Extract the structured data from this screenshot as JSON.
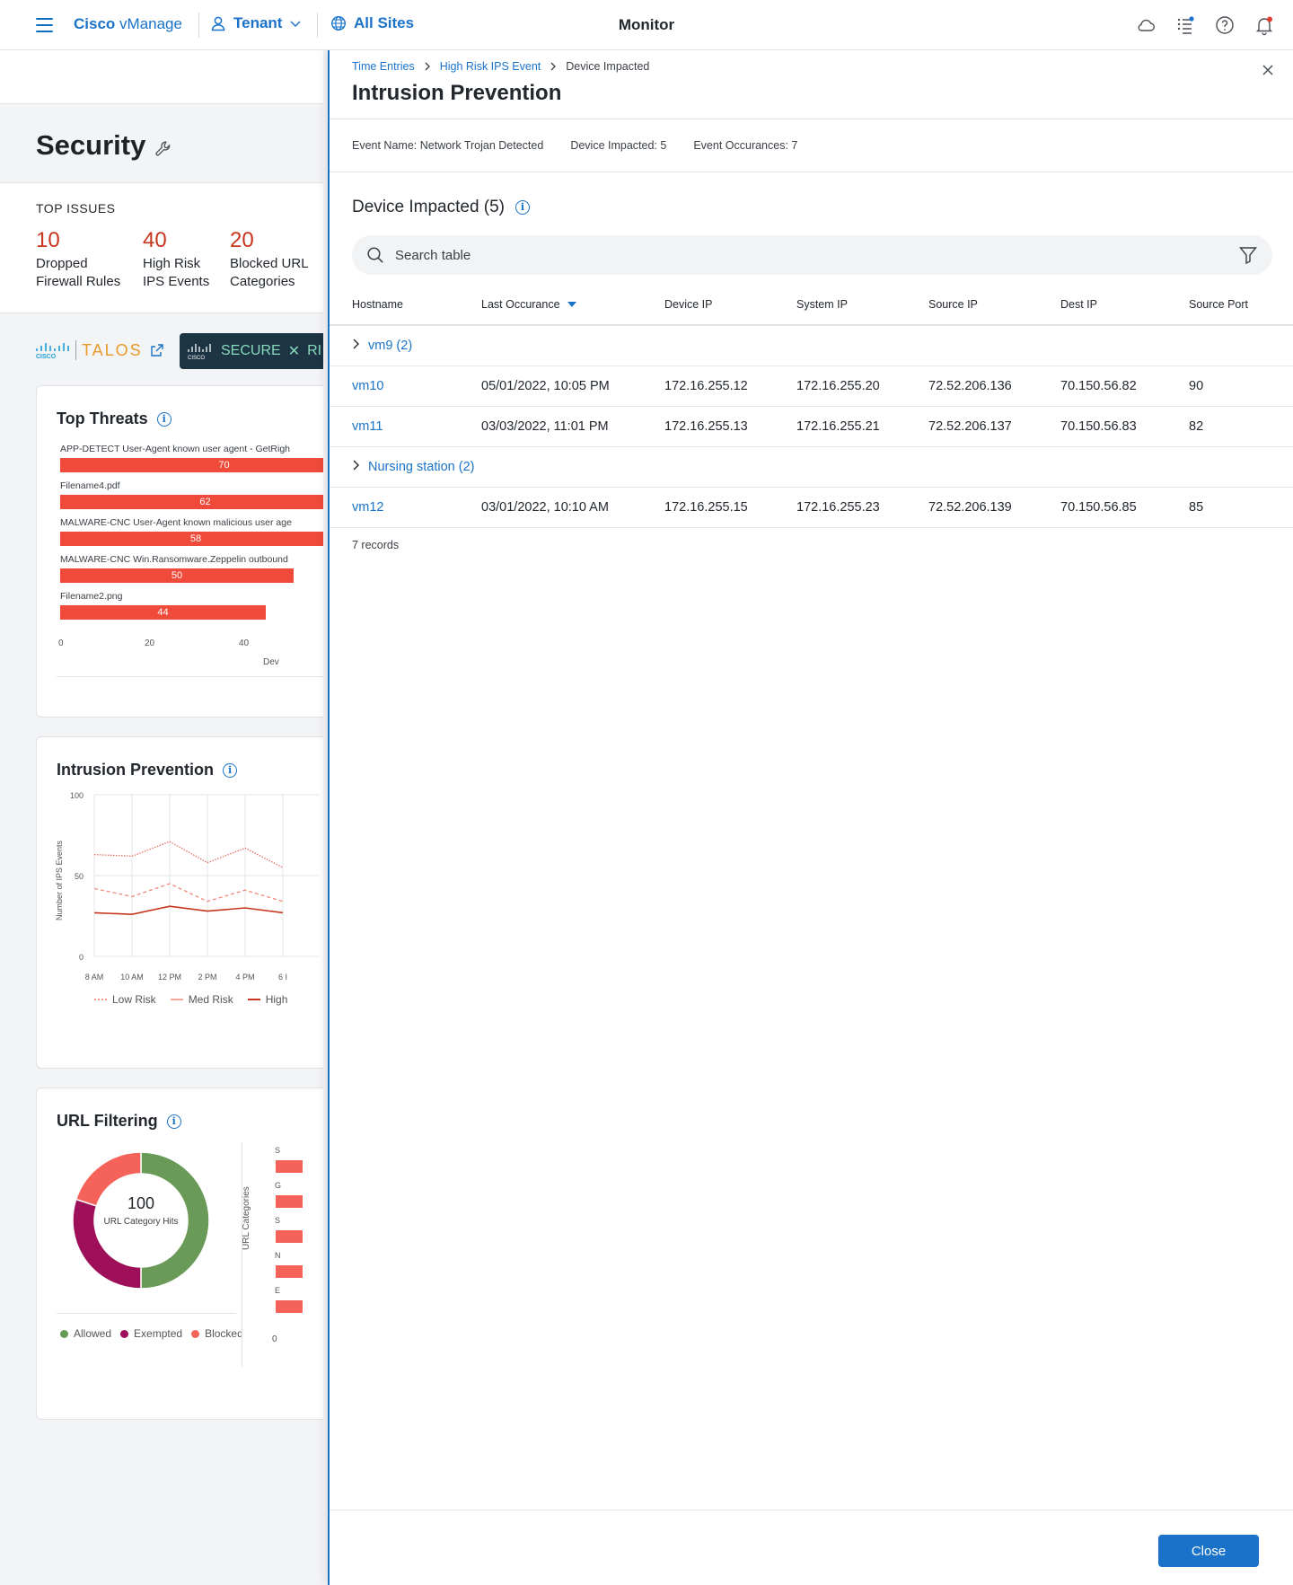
{
  "header": {
    "brand_bold": "Cisco",
    "brand_rest": "vManage",
    "tenant": "Tenant",
    "all_sites": "All Sites",
    "title": "Monitor"
  },
  "page": {
    "title": "Security",
    "top_issues": {
      "title": "TOP ISSUES",
      "items": [
        {
          "value": "10",
          "line1": "Dropped",
          "line2": "Firewall Rules"
        },
        {
          "value": "40",
          "line1": "High Risk",
          "line2": "IPS Events"
        },
        {
          "value": "20",
          "line1": "Blocked URL",
          "line2": "Categories"
        }
      ]
    },
    "brands": {
      "talos": "TALOS",
      "securex": "SECURE",
      "securex_cut": "RI"
    }
  },
  "top_threats": {
    "title": "Top Threats",
    "rows": [
      {
        "label": "APP-DETECT User-Agent known user agent - GetRigh",
        "value": 70
      },
      {
        "label": "Filename4.pdf",
        "value": 62
      },
      {
        "label": "MALWARE-CNC User-Agent known malicious user age",
        "value": 58
      },
      {
        "label": "MALWARE-CNC Win.Ransomware.Zeppelin outbound",
        "value": 50
      },
      {
        "label": "Filename2.png",
        "value": 44
      }
    ],
    "ticks": [
      "0",
      "20",
      "40"
    ],
    "axis_cut": "Dev"
  },
  "intrusion_card": {
    "title": "Intrusion Prevention",
    "ylabel": "Number of IPS Events",
    "y_ticks": [
      "100",
      "50",
      "0"
    ],
    "x_ticks": [
      "8 AM",
      "10 AM",
      "12 PM",
      "2 PM",
      "4 PM",
      "6 I"
    ],
    "legend": [
      "Low Risk",
      "Med Risk",
      "High"
    ],
    "series": [
      {
        "name": "Low Risk",
        "color": "#e8735f",
        "values": [
          63,
          62,
          71,
          58,
          67,
          55
        ]
      },
      {
        "name": "Med Risk",
        "color": "#f08a7a",
        "values": [
          42,
          37,
          45,
          34,
          41,
          34
        ]
      },
      {
        "name": "High",
        "color": "#c7361c",
        "values": [
          27,
          26,
          31,
          28,
          30,
          27
        ]
      }
    ]
  },
  "url_filtering": {
    "title": "URL Filtering",
    "center_value": "100",
    "center_label": "URL Category Hits",
    "ylabel": "URL Categories",
    "slices": [
      {
        "name": "Allowed",
        "value": 50,
        "color": "#6a9a58"
      },
      {
        "name": "Exempted",
        "value": 30,
        "color": "#9e0f5a"
      },
      {
        "name": "Blocked",
        "value": 20,
        "color": "#f4625a"
      }
    ],
    "bar_letters": [
      "S",
      "G",
      "S",
      "N",
      "E"
    ],
    "zero": "0"
  },
  "drawer": {
    "breadcrumbs": [
      "Time Entries",
      "High Risk IPS Event",
      "Device Impacted"
    ],
    "title": "Intrusion Prevention",
    "summary": {
      "event_name_label": "Event Name:",
      "event_name": "Network Trojan Detected",
      "device_impacted_label": "Device Impacted:",
      "device_impacted": "5",
      "event_occ_label": "Event Occurances:",
      "event_occ": "7"
    },
    "section_title": "Device Impacted (5)",
    "search_placeholder": "Search table",
    "columns": [
      "Hostname",
      "Last Occurance",
      "Device IP",
      "System IP",
      "Source IP",
      "Dest IP",
      "Source Port"
    ],
    "rows": [
      {
        "group": "vm9 (2)"
      },
      {
        "cells": [
          "vm10",
          "05/01/2022, 10:05 PM",
          "172.16.255.12",
          "172.16.255.20",
          "72.52.206.136",
          "70.150.56.82",
          "90"
        ]
      },
      {
        "cells": [
          "vm11",
          "03/03/2022, 11:01 PM",
          "172.16.255.13",
          "172.16.255.21",
          "72.52.206.137",
          "70.150.56.83",
          "82"
        ]
      },
      {
        "group": "Nursing station (2)"
      },
      {
        "cells": [
          "vm12",
          "03/01/2022, 10:10 AM",
          "172.16.255.15",
          "172.16.255.23",
          "72.52.206.139",
          "70.150.56.85",
          "85"
        ]
      }
    ],
    "records": "7 records",
    "close_label": "Close"
  }
}
